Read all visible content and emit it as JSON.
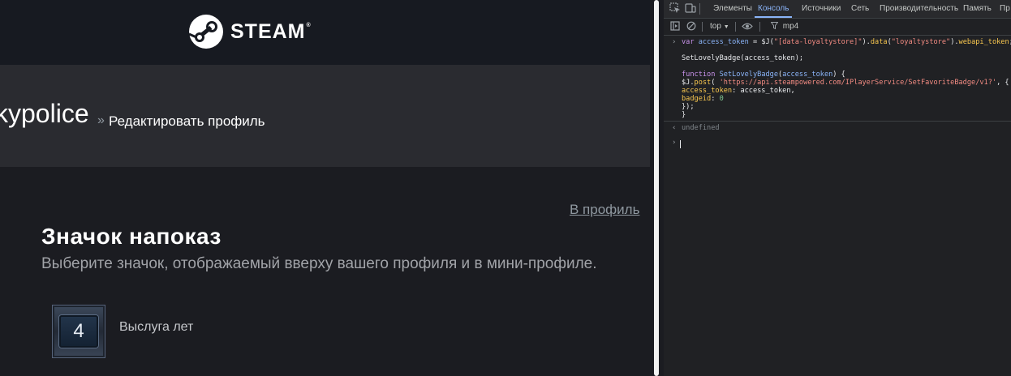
{
  "steam": {
    "logo_text": "STEAM",
    "logo_reg": "®",
    "profile_name": "kypolice",
    "breadcrumb_sep": "»",
    "breadcrumb_current": "Редактировать профиль",
    "back_link": "В профиль",
    "section_title": "Значок напоказ",
    "section_subtitle": "Выберите значок, отображаемый вверху вашего профиля и в мини-профиле.",
    "badge": {
      "level": "4",
      "name": "Выслуга лет"
    }
  },
  "devtools": {
    "tabs": [
      "Элементы",
      "Консоль",
      "Источники",
      "Сеть",
      "Производительность",
      "Память",
      "Пр"
    ],
    "active_tab": "Консоль",
    "context": "top",
    "filter": "mp4",
    "console": {
      "l1": [
        "var ",
        "access_token",
        " = $J(",
        "\"[data-loyaltystore]\"",
        ").",
        "data",
        "(",
        "\"loyaltystore\"",
        ").",
        "webapi_token",
        ";"
      ],
      "l2": "SetLovelyBadge(access_token);",
      "l3": [
        "function ",
        "SetLovelyBadge",
        "(",
        "access_token",
        ") {"
      ],
      "l4": [
        "$J.",
        "post",
        "( ",
        "'https://api.steampowered.com/IPlayerService/SetFavoriteBadge/v1?'",
        ", {"
      ],
      "l5": [
        "access_token",
        ": access_token,"
      ],
      "l6": [
        "badgeid",
        ": ",
        "0"
      ],
      "l7": "});",
      "l8": "}",
      "result": "undefined"
    }
  },
  "colors": {
    "steam_header": "#171a21",
    "profile_band": "#2a2b30",
    "page_bg": "#1b1c21",
    "devtools_bg": "#202124",
    "accent": "#8ab4f8"
  }
}
